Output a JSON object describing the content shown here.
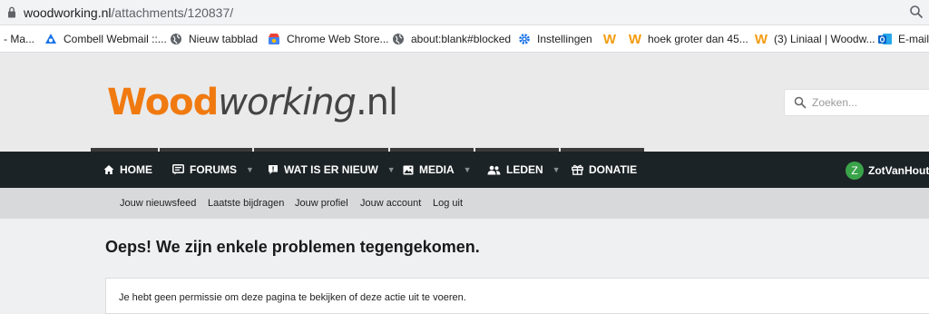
{
  "browser": {
    "url_host": "woodworking.nl",
    "url_path": "/attachments/120837/",
    "bookmarks": [
      {
        "label": "- Ma...",
        "icon": "none"
      },
      {
        "label": "Combell Webmail ::...",
        "icon": "combell-icon"
      },
      {
        "label": "Nieuw tabblad",
        "icon": "globe-icon"
      },
      {
        "label": "Chrome Web Store...",
        "icon": "webstore-icon"
      },
      {
        "label": "about:blank#blocked",
        "icon": "globe-icon"
      },
      {
        "label": "Instellingen",
        "icon": "gear-icon"
      },
      {
        "label": "",
        "icon": "woodworking-w-icon"
      },
      {
        "label": "hoek groter dan 45...",
        "icon": "woodworking-w-icon"
      },
      {
        "label": "(3) Liniaal | Woodw...",
        "icon": "woodworking-w-icon"
      },
      {
        "label": "E-mail",
        "icon": "outlook-icon"
      }
    ]
  },
  "header": {
    "logo_wood": "Wood",
    "logo_working": "working",
    "logo_tld": ".nl",
    "search_placeholder": "Zoeken..."
  },
  "nav": {
    "items": [
      {
        "label": "HOME",
        "icon": "home-icon",
        "dropdown": false
      },
      {
        "label": "FORUMS",
        "icon": "forum-icon",
        "dropdown": true
      },
      {
        "label": "WAT IS ER NIEUW",
        "icon": "whats-new-icon",
        "dropdown": true
      },
      {
        "label": "MEDIA",
        "icon": "image-icon",
        "dropdown": true
      },
      {
        "label": "LEDEN",
        "icon": "members-icon",
        "dropdown": true
      },
      {
        "label": "DONATIE",
        "icon": "gift-icon",
        "dropdown": false
      }
    ],
    "user_initial": "Z",
    "username": "ZotVanHout"
  },
  "subnav": {
    "links": [
      "Jouw nieuwsfeed",
      "Laatste bijdragen",
      "Jouw profiel",
      "Jouw account",
      "Log uit"
    ]
  },
  "content": {
    "title": "Oeps! We zijn enkele problemen tegengekomen.",
    "message": "Je hebt geen permissie om deze pagina te bekijken of deze actie uit te voeren."
  },
  "colors": {
    "logo_orange": "#f07a10",
    "navbar_bg": "#1c2326",
    "avatar_green": "#3aa34a",
    "subnav_bg": "#d7d9db"
  }
}
